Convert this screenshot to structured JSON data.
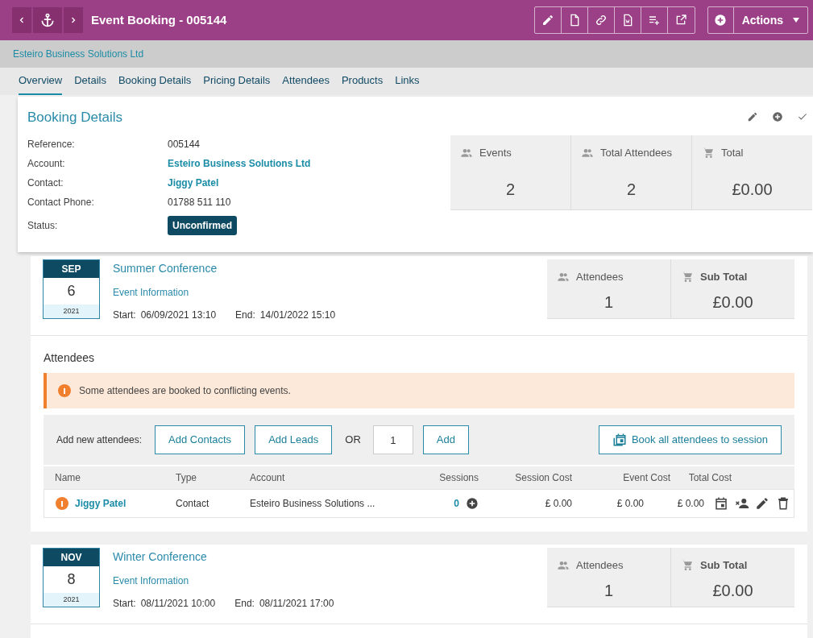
{
  "header": {
    "title": "Event Booking - 005144",
    "actions_button": "Actions"
  },
  "account_bar": {
    "account": "Esteiro Business Solutions Ltd"
  },
  "tabs": [
    {
      "label": "Overview",
      "selected": true
    },
    {
      "label": "Details",
      "selected": false
    },
    {
      "label": "Booking Details",
      "selected": false
    },
    {
      "label": "Pricing Details",
      "selected": false
    },
    {
      "label": "Attendees",
      "selected": false
    },
    {
      "label": "Products",
      "selected": false
    },
    {
      "label": "Links",
      "selected": false
    }
  ],
  "booking_details": {
    "title": "Booking Details",
    "fields": [
      {
        "label": "Reference:",
        "value": "005144",
        "kind": "text"
      },
      {
        "label": "Account:",
        "value": "Esteiro Business Solutions Ltd",
        "kind": "link"
      },
      {
        "label": "Contact:",
        "value": "Jiggy Patel",
        "kind": "link"
      },
      {
        "label": "Contact Phone:",
        "value": "01788 511 110",
        "kind": "text"
      },
      {
        "label": "Status:",
        "value": "Unconfirmed",
        "kind": "badge"
      }
    ],
    "stats": [
      {
        "label": "Events",
        "value": "2",
        "kind": "people"
      },
      {
        "label": "Total Attendees",
        "value": "2",
        "kind": "people"
      },
      {
        "label": "Total",
        "value": "£0.00",
        "kind": "cart"
      }
    ]
  },
  "events": [
    {
      "month": "SEP",
      "day": "6",
      "year": "2021",
      "name": "Summer Conference",
      "info_link": "Event Information",
      "start_label": "Start:",
      "start": "06/09/2021 13:10",
      "end_label": "End:",
      "end": "14/01/2022 15:10",
      "stats": [
        {
          "label": "Attendees",
          "value": "1",
          "kind": "people"
        },
        {
          "label": "Sub Total",
          "value": "£0.00",
          "kind": "cart"
        }
      ],
      "attendees": {
        "title": "Attendees",
        "alert": "Some attendees are booked to conflicting events.",
        "add_label": "Add new attendees:",
        "add_contacts": "Add Contacts",
        "add_leads": "Add Leads",
        "or": "OR",
        "quantity": "1",
        "add": "Add",
        "book_all": "Book all attendees to session",
        "columns": [
          "Name",
          "Type",
          "Account",
          "Sessions",
          "Session Cost",
          "Event Cost",
          "Total Cost"
        ],
        "rows": [
          {
            "name": "Jiggy Patel",
            "warning": true,
            "type": "Contact",
            "account": "Esteiro Business Solutions ...",
            "sessions": "0",
            "session_cost": "£ 0.00",
            "event_cost": "£ 0.00",
            "total_cost": "£ 0.00"
          }
        ]
      }
    },
    {
      "month": "NOV",
      "day": "8",
      "year": "2021",
      "name": "Winter Conference",
      "info_link": "Event Information",
      "start_label": "Start:",
      "start": "08/11/2021 10:00",
      "end_label": "End:",
      "end": "08/11/2021 17:00",
      "stats": [
        {
          "label": "Attendees",
          "value": "1",
          "kind": "people"
        },
        {
          "label": "Sub Total",
          "value": "£0.00",
          "kind": "cart"
        }
      ]
    }
  ]
}
